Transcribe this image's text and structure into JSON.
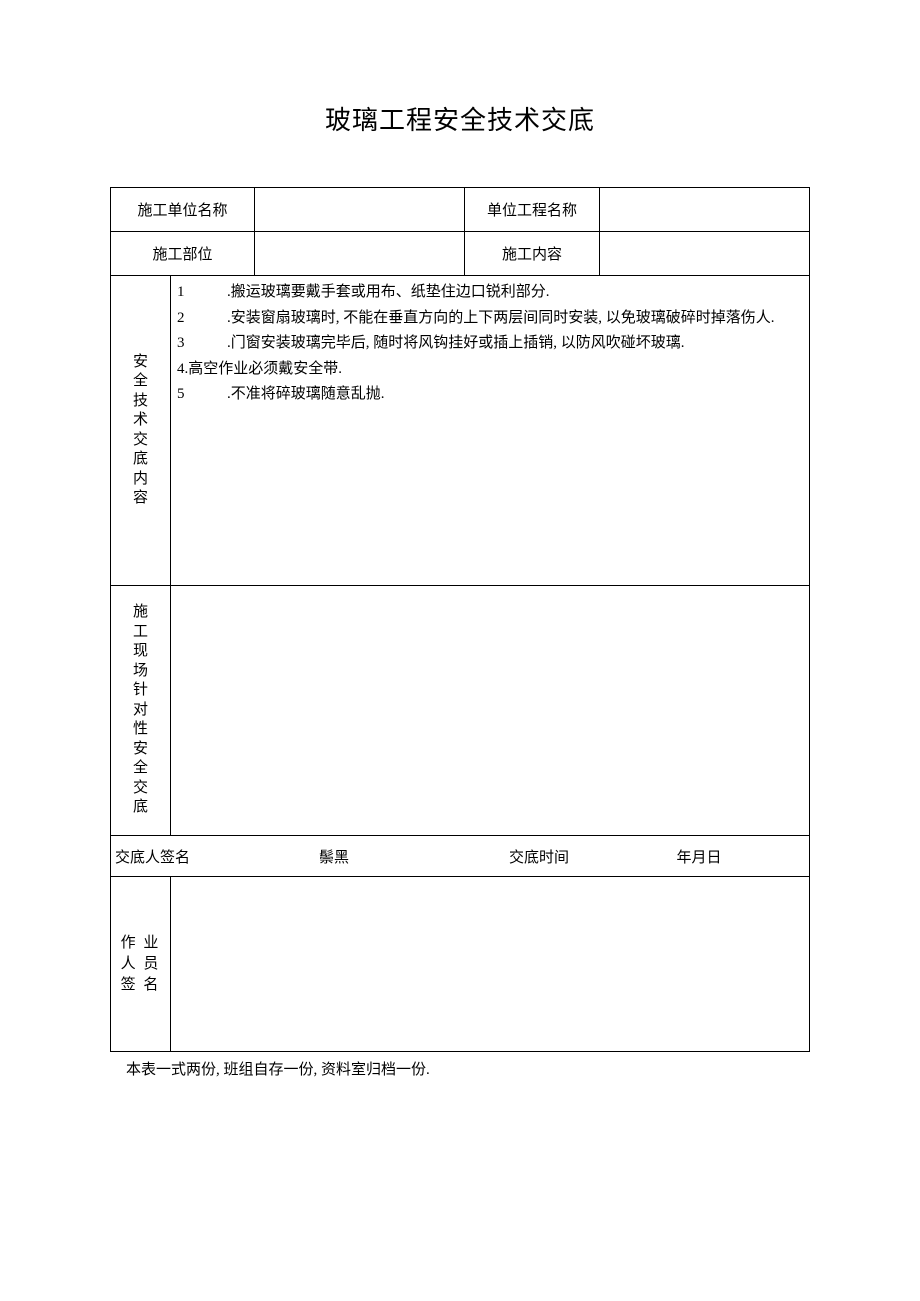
{
  "title": "玻璃工程安全技术交底",
  "row1": {
    "label1": "施工单位名称",
    "value1": "",
    "label2": "单位工程名称",
    "value2": ""
  },
  "row2": {
    "label1": "施工部位",
    "value1": "",
    "label2": "施工内容",
    "value2": ""
  },
  "section1": {
    "label": "安全技术交底内容",
    "items": [
      {
        "num": "1",
        "text": ".搬运玻璃要戴手套或用布、纸垫住边口锐利部分."
      },
      {
        "num": "2",
        "text": ".安装窗扇玻璃时, 不能在垂直方向的上下两层间同时安装, 以免玻璃破碎时掉落伤人."
      },
      {
        "num": "3",
        "text": ".门窗安装玻璃完毕后, 随时将风钩挂好或插上插销, 以防风吹碰坏玻璃."
      },
      {
        "num": "4.",
        "text": "高空作业必须戴安全带.",
        "tight": true
      },
      {
        "num": "5",
        "text": ".不准将碎玻璃随意乱抛."
      }
    ]
  },
  "section2": {
    "label": "施工现场针对性安全交底",
    "content": ""
  },
  "signRow": {
    "label1": "交底人签名",
    "value1": "鬃黑",
    "label2": "交底时间",
    "value2": "年月日"
  },
  "workerRow": {
    "label": "作 业\n人 员\n签 名",
    "value": ""
  },
  "footnote": "本表一式两份, 班组自存一份, 资料室归档一份."
}
